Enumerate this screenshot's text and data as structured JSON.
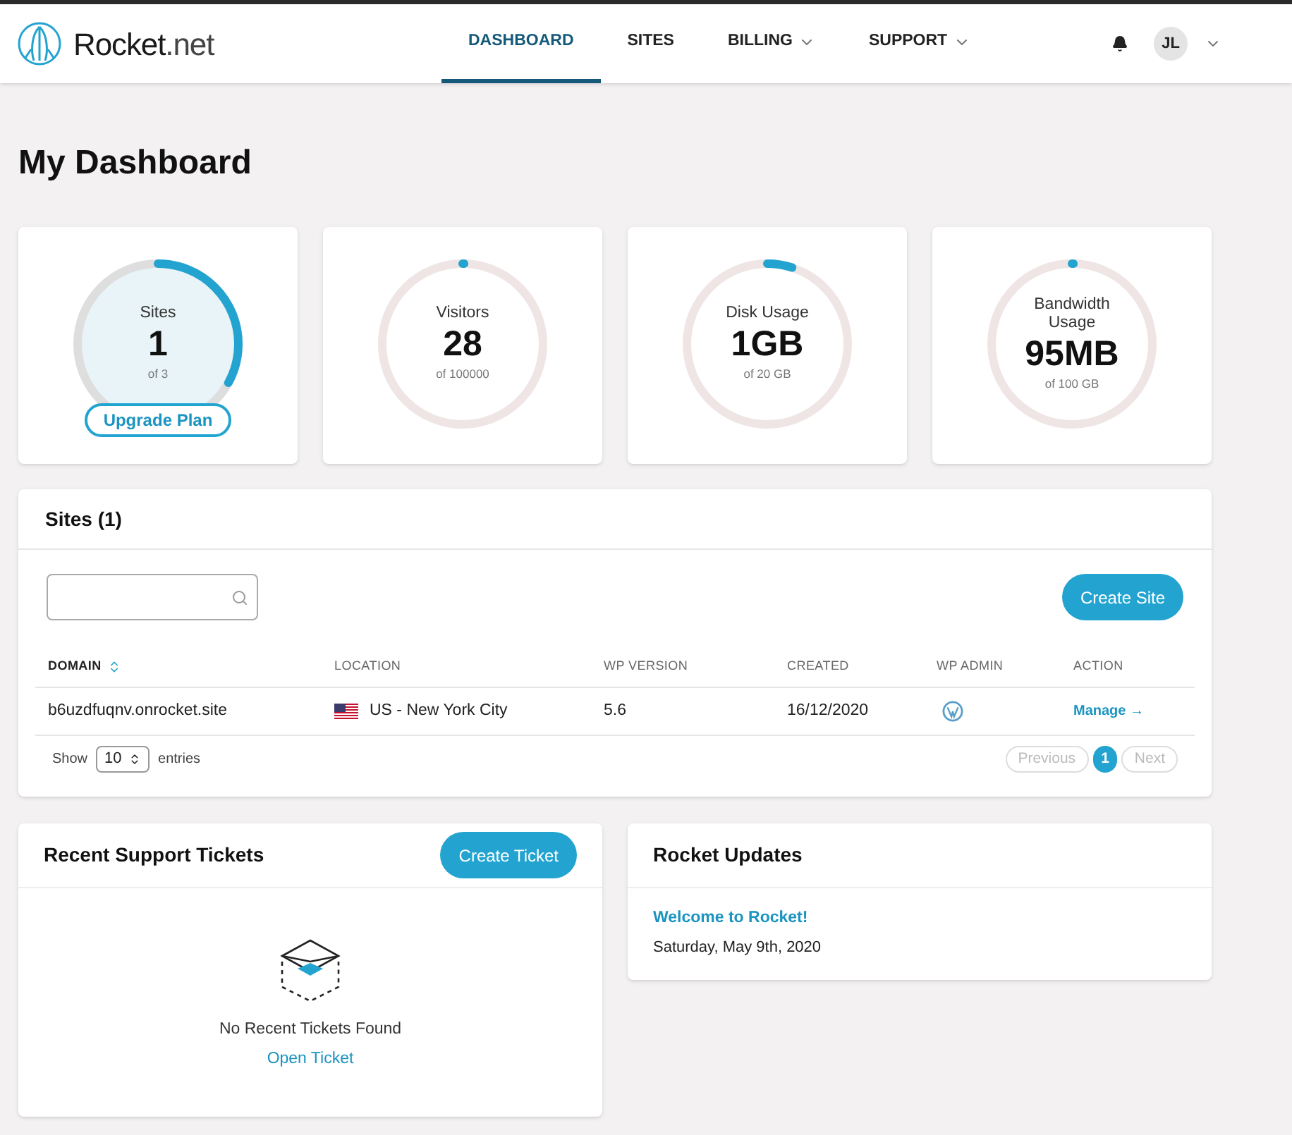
{
  "header": {
    "brand": "Rocket",
    "brand_suffix": ".net",
    "nav": [
      {
        "label": "DASHBOARD",
        "selected": true,
        "dropdown": false
      },
      {
        "label": "SITES",
        "selected": false,
        "dropdown": false
      },
      {
        "label": "BILLING",
        "selected": false,
        "dropdown": true
      },
      {
        "label": "SUPPORT",
        "selected": false,
        "dropdown": true
      }
    ],
    "avatar": "JL"
  },
  "page_title": "My Dashboard",
  "stats": [
    {
      "label": "Sites",
      "value": "1",
      "limit": "of 3",
      "level": 0.33,
      "highlighted": true,
      "button": "Upgrade Plan"
    },
    {
      "label": "Visitors",
      "value": "28",
      "limit": "of 100000",
      "level": 0.003,
      "highlighted": false
    },
    {
      "label": "Disk Usage",
      "value": "1GB",
      "limit": "of 20 GB",
      "level": 0.05,
      "highlighted": false
    },
    {
      "label": "Bandwidth Usage",
      "value": "95MB",
      "limit": "of 100 GB",
      "level": 0.003,
      "highlighted": false
    }
  ],
  "sites": {
    "title": "Sites (1)",
    "create_button": "Create Site",
    "columns": [
      "DOMAIN",
      "LOCATION",
      "WP VERSION",
      "CREATED",
      "WP ADMIN",
      "ACTION"
    ],
    "rows": [
      {
        "domain": "b6uzdfuqnv.onrocket.site",
        "location": "US - New York City",
        "wp_version": "5.6",
        "created": "16/12/2020",
        "action": "Manage →"
      }
    ],
    "show_label": "Show",
    "page_size": "10",
    "entries_label": "entries",
    "pagination": [
      {
        "label": "Previous",
        "selected": false
      },
      {
        "label": "1",
        "selected": true
      },
      {
        "label": "Next",
        "selected": false
      }
    ]
  },
  "tickets": {
    "title": "Recent Support Tickets",
    "create_button": "Create Ticket",
    "empty_text": "No Recent Tickets Found",
    "link": "Open Ticket"
  },
  "updates": {
    "title": "Rocket Updates",
    "items": [
      {
        "title": "Welcome to Rocket!",
        "date": "Saturday, May 9th, 2020"
      }
    ]
  }
}
